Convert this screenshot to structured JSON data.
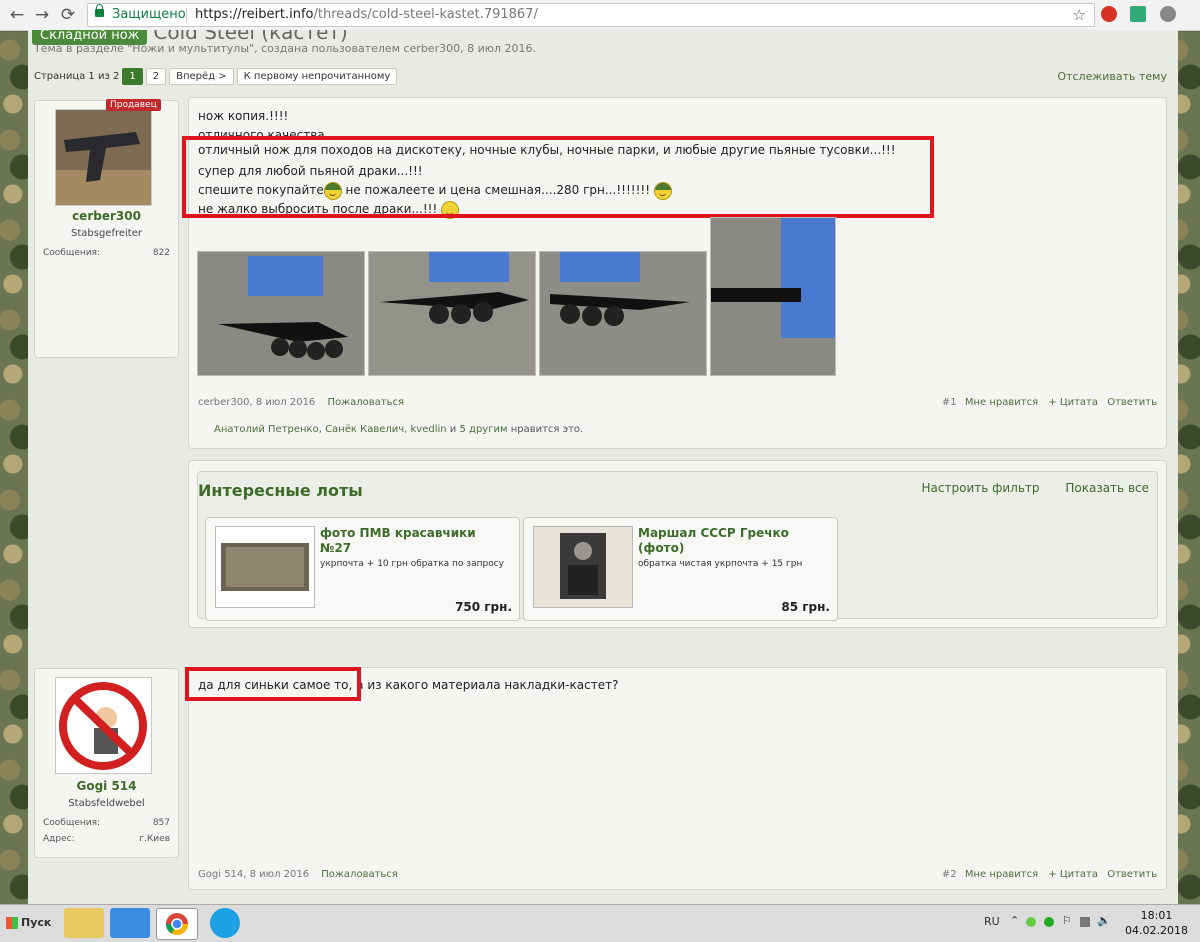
{
  "browser": {
    "secure_label": "Защищено",
    "url_host": "https://reibert.info",
    "url_path": "/threads/cold-steel-kastet.791867/"
  },
  "thread": {
    "prefix": "Складной нож",
    "title": "Cold Steel (кастет)",
    "description": "Тема в разделе \"Ножи и мультитулы\", создана пользователем cerber300, 8 июл 2016.",
    "page_label": "Страница 1 из 2",
    "pages": [
      "1",
      "2"
    ],
    "next_label": "Вперёд >",
    "first_unread_label": "К первому непрочитанному",
    "watch_label": "Отслеживать тему"
  },
  "post1": {
    "user": {
      "badge": "Продавец",
      "name": "cerber300",
      "title": "Stabsgefreiter",
      "messages_label": "Сообщения:",
      "messages": "822"
    },
    "lines": [
      "нож копия.!!!!",
      "отличного качества.",
      "отличный нож для походов на дискотеку, ночные клубы, ночные парки, и любые другие пьяные тусовки...!!!",
      "супер для любой пьяной драки...!!!",
      "спешите покупайте",
      " не пожалеете и цена смешная....280 грн...!!!!!!!",
      "не жалко выбросить после драки...!!!"
    ],
    "author_date": "cerber300, 8 июл 2016",
    "report": "Пожаловаться",
    "num": "#1",
    "like": "Мне нравится",
    "quote": "+ Цитата",
    "reply": "Ответить",
    "likes_names": "Анатолий Петренко, Санёк Кавелич, kvedlin",
    "likes_and": " и ",
    "likes_others": "5 другим",
    "likes_suffix": " нравится это."
  },
  "lots": {
    "heading": "Интересные лоты",
    "filter": "Настроить фильтр",
    "show_all": "Показать все",
    "items": [
      {
        "title": "фото ПМВ красавчики №27",
        "desc": "укрпочта + 10 грн обратка по запросу",
        "price": "750 грн."
      },
      {
        "title": "Маршал СССР Гречко (фото)",
        "desc": "обратка чистая укрпочта + 15 грн",
        "price": "85 грн."
      }
    ]
  },
  "post2": {
    "user": {
      "name": "Gogi 514",
      "title": "Stabsfeldwebel",
      "messages_label": "Сообщения:",
      "messages": "857",
      "address_label": "Адрес:",
      "address": "г.Киев"
    },
    "text_highlight": "да для синьки самое то,",
    "text_rest": " а из какого материала накладки-кастет?",
    "author_date": "Gogi 514, 8 июл 2016",
    "report": "Пожаловаться",
    "num": "#2",
    "like": "Мне нравится",
    "quote": "+ Цитата",
    "reply": "Ответить"
  },
  "taskbar": {
    "start": "Пуск",
    "lang": "RU",
    "time": "18:01",
    "date": "04.02.2018"
  }
}
